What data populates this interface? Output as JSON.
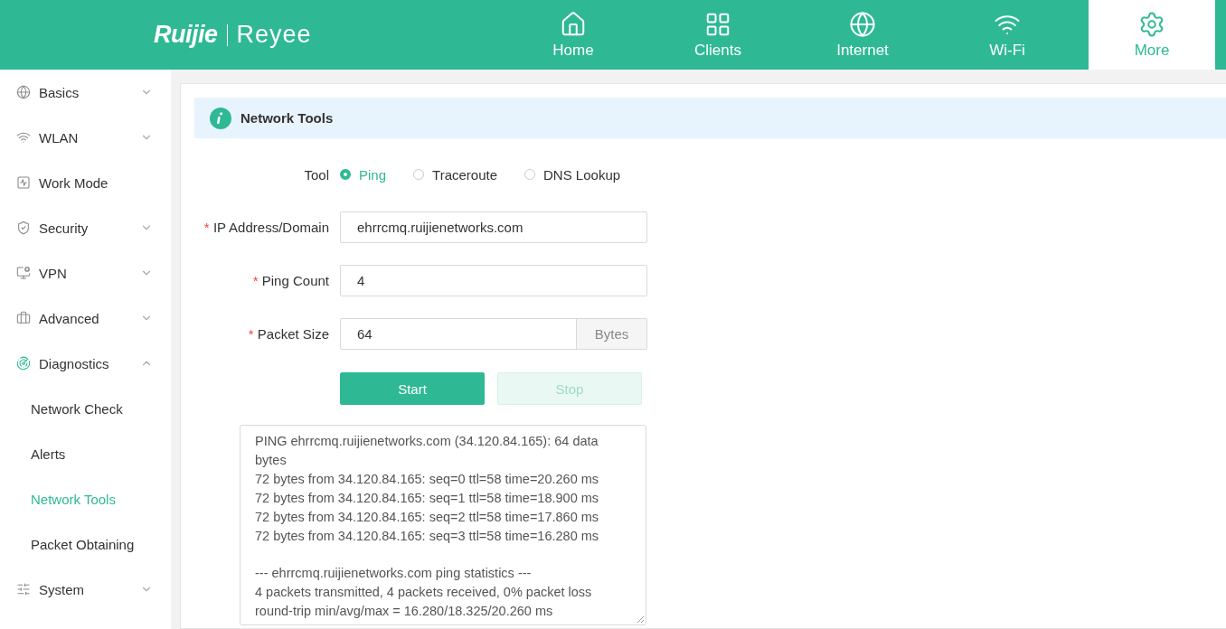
{
  "header": {
    "logo": {
      "brand": "Ruijie",
      "product": "Reyee"
    },
    "nav": [
      {
        "label": "Home",
        "selected": false
      },
      {
        "label": "Clients",
        "selected": false
      },
      {
        "label": "Internet",
        "selected": false
      },
      {
        "label": "Wi-Fi",
        "selected": false
      },
      {
        "label": "More",
        "selected": true
      }
    ]
  },
  "sidebar": {
    "items": [
      {
        "label": "Basics",
        "kind": "group",
        "expanded": false
      },
      {
        "label": "WLAN",
        "kind": "group",
        "expanded": false
      },
      {
        "label": "Work Mode",
        "kind": "link"
      },
      {
        "label": "Security",
        "kind": "group",
        "expanded": false
      },
      {
        "label": "VPN",
        "kind": "group",
        "expanded": false
      },
      {
        "label": "Advanced",
        "kind": "group",
        "expanded": false
      },
      {
        "label": "Diagnostics",
        "kind": "group",
        "expanded": true,
        "children": [
          {
            "label": "Network Check",
            "selected": false
          },
          {
            "label": "Alerts",
            "selected": false
          },
          {
            "label": "Network Tools",
            "selected": true
          },
          {
            "label": "Packet Obtaining",
            "selected": false
          }
        ]
      },
      {
        "label": "System",
        "kind": "group",
        "expanded": false
      }
    ]
  },
  "page": {
    "title": "Network Tools",
    "tool": {
      "label": "Tool",
      "options": [
        {
          "label": "Ping",
          "selected": true
        },
        {
          "label": "Traceroute",
          "selected": false
        },
        {
          "label": "DNS Lookup",
          "selected": false
        }
      ]
    },
    "fields": [
      {
        "required_mark": "*",
        "label": "IP Address/Domain",
        "value": "ehrrcmq.ruijienetworks.com"
      },
      {
        "required_mark": "*",
        "label": "Ping Count",
        "value": "4"
      },
      {
        "required_mark": "*",
        "label": "Packet Size",
        "value": "64",
        "unit": "Bytes"
      }
    ],
    "buttons": [
      {
        "label": "Start",
        "disabled": false
      },
      {
        "label": "Stop",
        "disabled": true
      }
    ],
    "output": [
      [
        "PING ehrrcmq.ruijienetworks.com (34.120.84.165): 64 data bytes",
        "72 bytes from 34.120.84.165: seq=0 ttl=58 time=20.260 ms",
        "72 bytes from 34.120.84.165: seq=1 ttl=58 time=18.900 ms",
        "72 bytes from 34.120.84.165: seq=2 ttl=58 time=17.860 ms",
        "72 bytes from 34.120.84.165: seq=3 ttl=58 time=16.280 ms"
      ],
      [
        "--- ehrrcmq.ruijienetworks.com ping statistics ---",
        "4 packets transmitted, 4 packets received, 0% packet loss",
        "round-trip min/avg/max = 16.280/18.325/20.260 ms"
      ]
    ]
  }
}
